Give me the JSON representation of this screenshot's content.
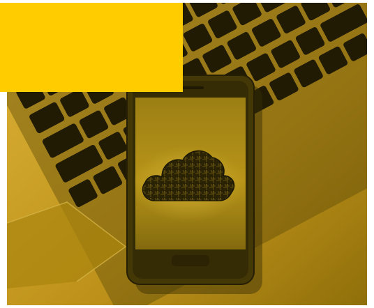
{
  "image": {
    "subject": "smartphone-with-cloud-icon-on-laptop-keyboard",
    "tint_color": "#d8a91e",
    "overlay_color": "#ffcc00",
    "icons": [
      "cloud-icon"
    ]
  }
}
